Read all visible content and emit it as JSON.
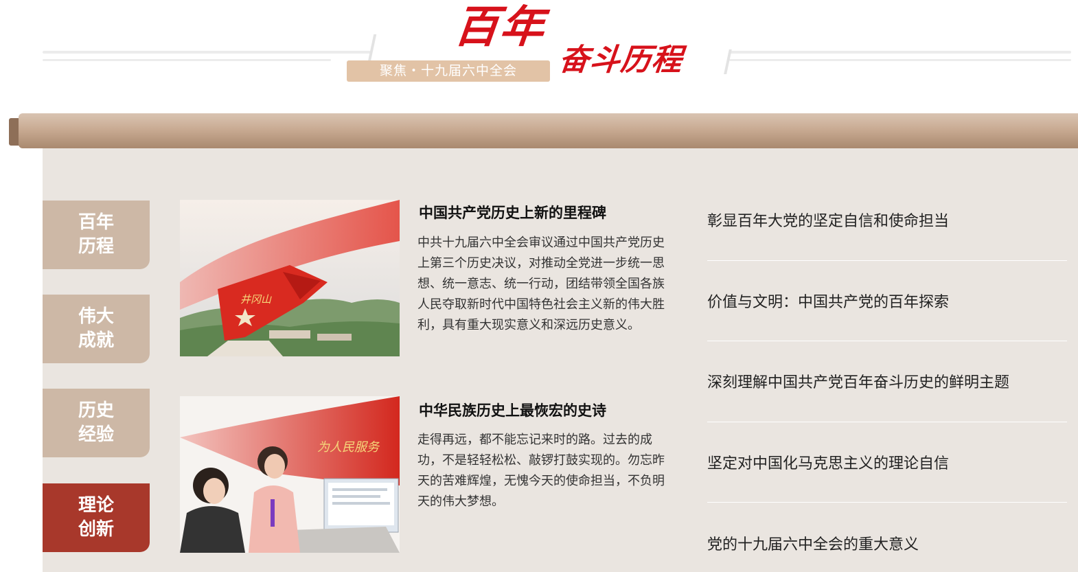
{
  "header": {
    "title_big": "百年",
    "title_small": "奋斗历程",
    "focus_label": "聚焦・十九届六中全会",
    "brand_color": "#d7121b"
  },
  "side_tabs": [
    {
      "label": "百年历程",
      "active": false
    },
    {
      "label": "伟大成就",
      "active": false
    },
    {
      "label": "历史经验",
      "active": false
    },
    {
      "label": "理论创新",
      "active": true
    }
  ],
  "main": {
    "articles": [
      {
        "title": "中国共产党历史上新的里程碑",
        "desc": "中共十九届六中全会审议通过中国共产党历史上第三个历史决议，对推动全党进一步统一思想、统一意志、统一行动，团结带领全国各族人民夺取新时代中国特色社会主义新的伟大胜利，具有重大现实意义和深远历史意义。",
        "image_sign": "井冈山"
      },
      {
        "title": "中华民族历史上最恢宏的史诗",
        "desc": "走得再远，都不能忘记来时的路。过去的成功，不是轻轻松松、敲锣打鼓实现的。勿忘昨天的苦难辉煌，无愧今天的使命担当，不负明天的伟大梦想。",
        "image_sign": "为人民服务"
      }
    ]
  },
  "right_list": [
    "彰显百年大党的坚定自信和使命担当",
    "价值与文明：中国共产党的百年探索",
    "深刻理解中国共产党百年奋斗历史的鲜明主题",
    "坚定对中国化马克思主义的理论自信",
    "党的十九届六中全会的重大意义"
  ],
  "colors": {
    "tab_inactive": "#cdb8a6",
    "tab_active": "#a8382b",
    "panel_bg": "#eae5e0",
    "bar": "#c9ab93"
  }
}
